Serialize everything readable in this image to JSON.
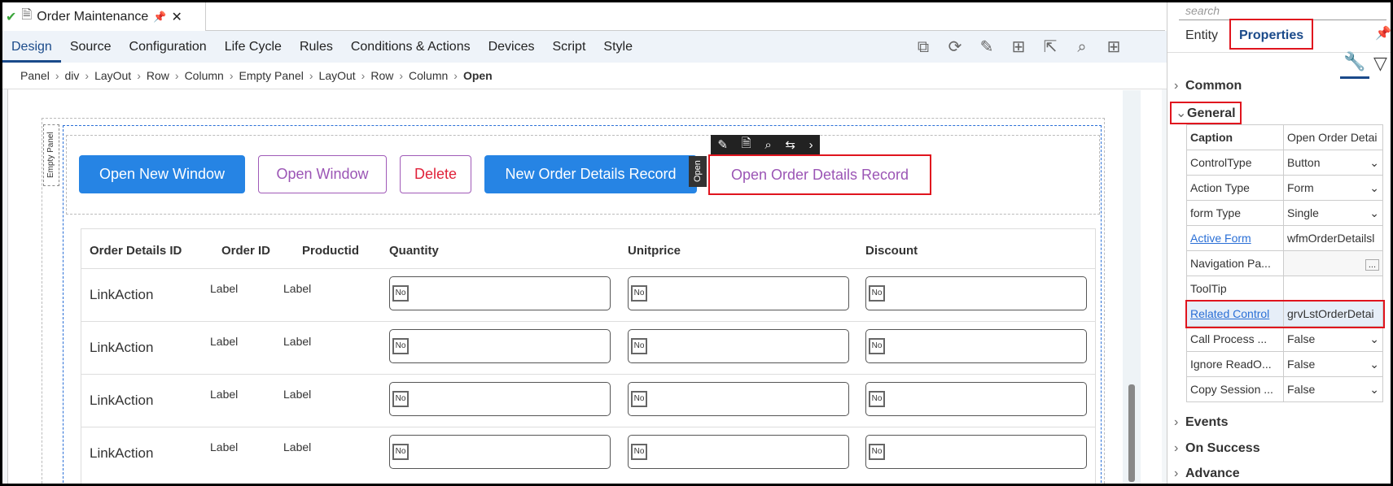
{
  "doc_tab": {
    "title": "Order Maintenance"
  },
  "nav_tabs": [
    "Design",
    "Source",
    "Configuration",
    "Life Cycle",
    "Rules",
    "Conditions & Actions",
    "Devices",
    "Script",
    "Style"
  ],
  "toolbar_icons": [
    "hierarchy-icon",
    "refresh-icon",
    "pencil-icon",
    "layout-icon",
    "external-link-icon",
    "search-icon",
    "add-icon"
  ],
  "breadcrumb": [
    "Panel",
    "div",
    "LayOut",
    "Row",
    "Column",
    "Empty Panel",
    "LayOut",
    "Row",
    "Column",
    "Open"
  ],
  "canvas": {
    "empty_panel_label": "Empty Panel",
    "buttons": {
      "open_new_window": "Open New Window",
      "open_window": "Open Window",
      "delete": "Delete",
      "new_order_details": "New Order Details Record",
      "open_order_details": "Open Order Details Record"
    },
    "selected_badge": "Open",
    "grid": {
      "columns": [
        "Order Details ID",
        "Order ID",
        "Productid",
        "Quantity",
        "Unitprice",
        "Discount"
      ],
      "rows": [
        {
          "link": "LinkAction",
          "order_id": "Label",
          "product": "Label",
          "no": "No"
        },
        {
          "link": "LinkAction",
          "order_id": "Label",
          "product": "Label",
          "no": "No"
        },
        {
          "link": "LinkAction",
          "order_id": "Label",
          "product": "Label",
          "no": "No"
        },
        {
          "link": "LinkAction",
          "order_id": "Label",
          "product": "Label",
          "no": "No"
        }
      ]
    }
  },
  "sidebar": {
    "search_placeholder": "search",
    "tabs": {
      "entity": "Entity",
      "properties": "Properties"
    },
    "sections": {
      "common": "Common",
      "general": "General",
      "events": "Events",
      "on_success": "On Success",
      "advance": "Advance"
    },
    "props": [
      {
        "k": "Caption",
        "v": "Open Order Detai"
      },
      {
        "k": "ControlType",
        "v": "Button"
      },
      {
        "k": "Action Type",
        "v": "Form"
      },
      {
        "k": "form Type",
        "v": "Single"
      },
      {
        "k": "Active Form",
        "v": "wfmOrderDetailsl"
      },
      {
        "k": "Navigation Pa...",
        "v": "..."
      },
      {
        "k": "ToolTip",
        "v": ""
      },
      {
        "k": "Related Control",
        "v": "grvLstOrderDetai"
      },
      {
        "k": "Call Process ...",
        "v": "False"
      },
      {
        "k": "Ignore ReadO...",
        "v": "False"
      },
      {
        "k": "Copy Session ...",
        "v": "False"
      }
    ]
  },
  "colors": {
    "accent": "#1a4a8a",
    "primary_button": "#2684e4",
    "highlight": "#e0141e"
  }
}
